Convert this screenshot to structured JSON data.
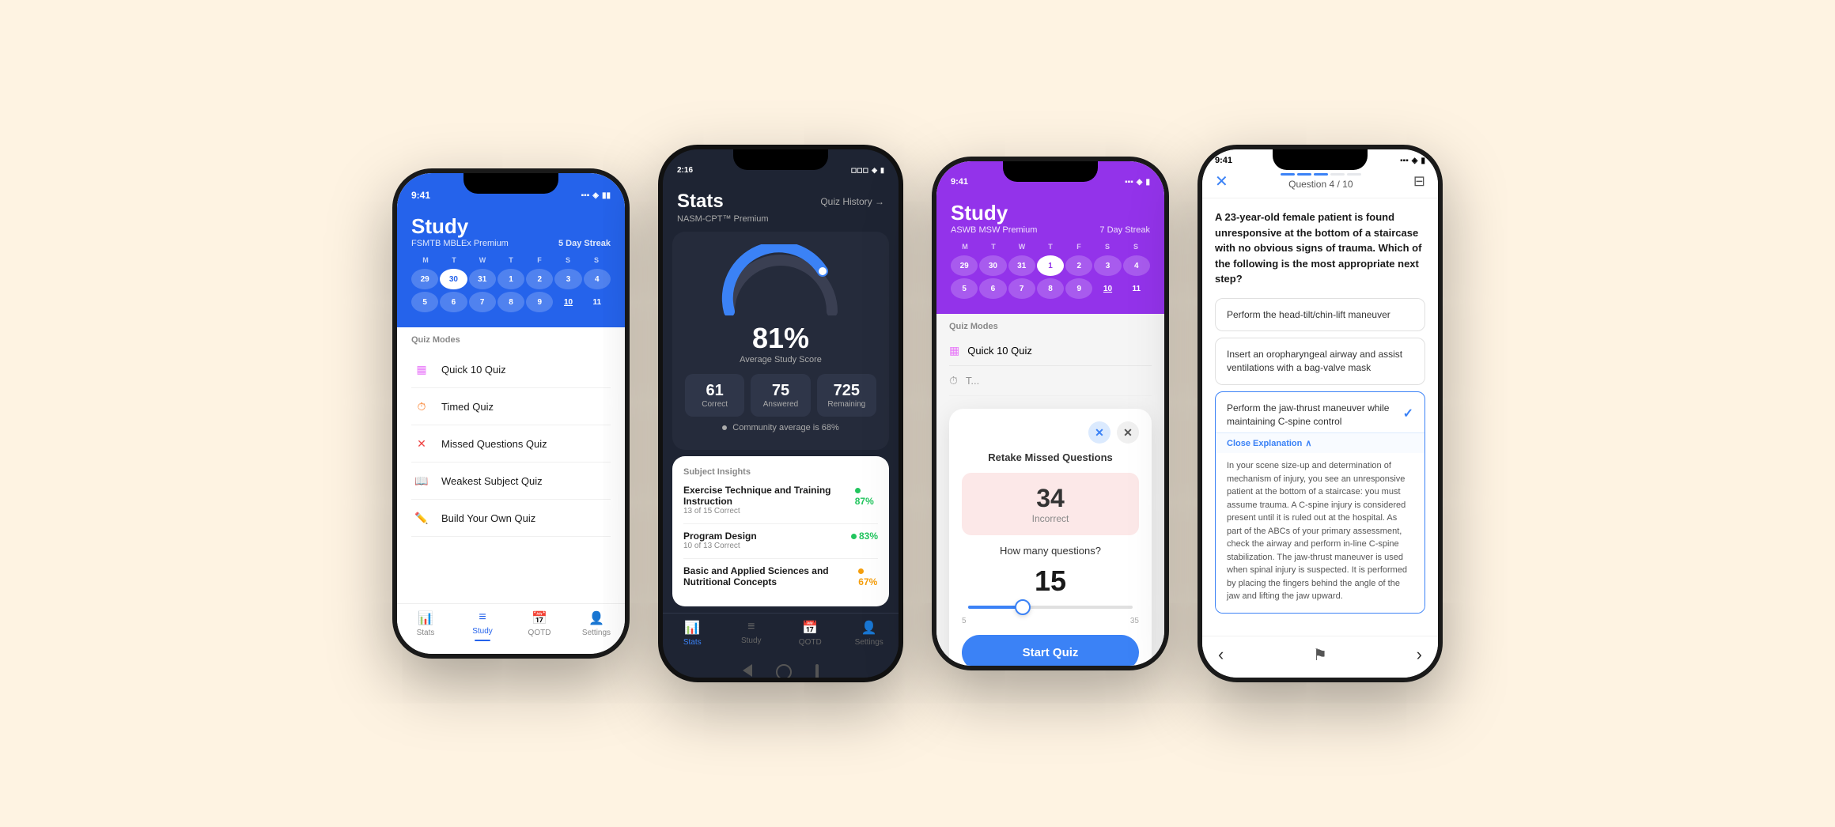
{
  "phone1": {
    "status_time": "9:41",
    "title": "Study",
    "subtitle": "FSMTB MBLEx Premium",
    "streak": "5 Day Streak",
    "days_labels": [
      "M",
      "T",
      "W",
      "T",
      "F",
      "S",
      "S"
    ],
    "calendar_row1": [
      "29",
      "30",
      "31",
      "1",
      "2",
      "3",
      "4"
    ],
    "calendar_row2": [
      "5",
      "6",
      "7",
      "8",
      "9",
      "10",
      "11"
    ],
    "today_index_r1": 1,
    "underlined_r2": 5,
    "quiz_modes_title": "Quiz Modes",
    "quiz_modes": [
      {
        "icon": "📋",
        "label": "Quick 10 Quiz"
      },
      {
        "icon": "⏱",
        "label": "Timed Quiz"
      },
      {
        "icon": "❌",
        "label": "Missed Questions Quiz"
      },
      {
        "icon": "📖",
        "label": "Weakest Subject Quiz"
      },
      {
        "icon": "✏️",
        "label": "Build Your Own Quiz"
      }
    ],
    "nav_items": [
      {
        "label": "Stats",
        "icon": "📊",
        "active": false
      },
      {
        "label": "Study",
        "icon": "📚",
        "active": true
      },
      {
        "label": "QOTD",
        "icon": "📅",
        "active": false
      },
      {
        "label": "Settings",
        "icon": "👤",
        "active": false
      }
    ]
  },
  "phone2": {
    "status_time": "2:16",
    "title": "Stats",
    "quiz_history": "Quiz History →",
    "cert_name": "NASM-CPT™ Premium",
    "gauge_pct": "81%",
    "gauge_label": "Average Study Score",
    "stat_correct": "61",
    "stat_correct_label": "Correct",
    "stat_answered": "75",
    "stat_answered_label": "Answered",
    "stat_remaining": "725",
    "stat_remaining_label": "Remaining",
    "community_avg": "Community average is 68%",
    "insights_title": "Subject Insights",
    "subjects": [
      {
        "name": "Exercise Technique and Training Instruction",
        "correct": "13 of 15 Correct",
        "pct": "87%",
        "color": "#22c55e"
      },
      {
        "name": "Program Design",
        "correct": "10 of 13 Correct",
        "pct": "83%",
        "color": "#22c55e"
      },
      {
        "name": "Basic and Applied Sciences and Nutritional Concepts",
        "correct": "",
        "pct": "67%",
        "color": "#f59e0b"
      }
    ],
    "nav_items": [
      {
        "label": "Stats",
        "icon": "📊",
        "active": true
      },
      {
        "label": "Study",
        "icon": "📚",
        "active": false
      },
      {
        "label": "QOTD",
        "icon": "📅",
        "active": false
      },
      {
        "label": "Settings",
        "icon": "👤",
        "active": false
      }
    ]
  },
  "phone3": {
    "status_time": "9:41",
    "title": "Study",
    "subtitle": "ASWB MSW Premium",
    "streak": "7 Day Streak",
    "quiz_modes_title": "Quiz Modes",
    "quiz_mode_label": "Quick 10 Quiz",
    "modal_title": "Retake Missed Questions",
    "incorrect_count": "34",
    "incorrect_label": "Incorrect",
    "how_many": "How many questions?",
    "question_count": "15",
    "slider_min": "5",
    "slider_max": "35",
    "start_btn": "Start Quiz"
  },
  "phone4": {
    "status_time": "9:41",
    "question_number": "Question 4 / 10",
    "question_text": "A 23-year-old female patient is found unresponsive at the bottom of a staircase with no obvious signs of trauma. Which of the following is the most appropriate next step?",
    "answers": [
      {
        "text": "Perform the head-tilt/chin-lift maneuver",
        "correct": false,
        "selected": false
      },
      {
        "text": "Insert an oropharyngeal airway and assist ventilations with a bag-valve mask",
        "correct": false,
        "selected": false
      },
      {
        "text": "Perform the jaw-thrust maneuver while maintaining C-spine control",
        "correct": true,
        "selected": true
      }
    ],
    "close_explanation_label": "Close Explanation",
    "explanation_text": "In your scene size-up and determination of mechanism of injury, you see an unresponsive patient at the bottom of a staircase: you must assume trauma. A C-spine injury is considered present until it is ruled out at the hospital. As part of the ABCs of your primary assessment, check the airway and perform in-line C-spine stabilization. The jaw-thrust maneuver is used when spinal injury is suspected. It is performed by placing the fingers behind the angle of the jaw and lifting the jaw upward."
  }
}
